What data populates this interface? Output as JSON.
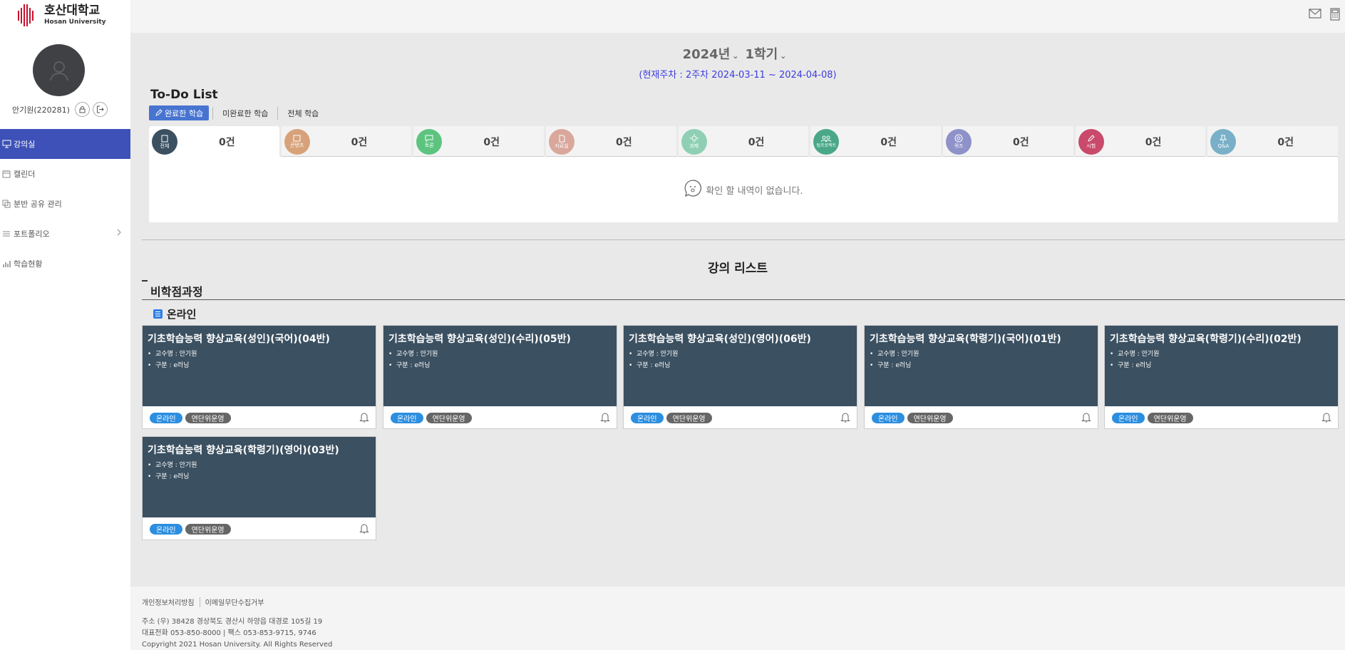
{
  "brand": {
    "name_ko": "호산대학교",
    "name_en": "Hosan University",
    "color": "#c8102e"
  },
  "user": {
    "name_id": "안기원(220281)"
  },
  "nav": {
    "items": [
      {
        "label": "강의실",
        "icon": "monitor-icon",
        "active": true
      },
      {
        "label": "캘린더",
        "icon": "calendar-icon"
      },
      {
        "label": "분반 공유 관리",
        "icon": "share-icon"
      },
      {
        "label": "포트폴리오",
        "icon": "list-icon",
        "expandable": true
      },
      {
        "label": "학습현황",
        "icon": "bar-chart-icon"
      }
    ]
  },
  "header": {
    "icons": [
      "mail-icon",
      "calculator-icon"
    ]
  },
  "term": {
    "year": "2024년",
    "semester": "1학기",
    "week": "(현재주차 : 2주차 2024-03-11 ~ 2024-04-08)"
  },
  "todo": {
    "title": "To-Do List",
    "filters": [
      "완료한 학습",
      "미완료한 학습",
      "전체 학습"
    ],
    "active_filter": "완료한 학습",
    "categories": [
      {
        "label": "전체",
        "count": "0건",
        "color": "#3b5061",
        "icon": "clipboard-icon"
      },
      {
        "label": "콘텐츠",
        "count": "0건",
        "color": "#d7a27a",
        "icon": "content-icon"
      },
      {
        "label": "토론",
        "count": "0건",
        "color": "#5dc47f",
        "icon": "discussion-icon"
      },
      {
        "label": "자료실",
        "count": "0건",
        "color": "#d9a79b",
        "icon": "folder-icon"
      },
      {
        "label": "과제",
        "count": "0건",
        "color": "#8fd0b5",
        "icon": "assignment-icon"
      },
      {
        "label": "팀프로젝트",
        "count": "0건",
        "color": "#4aa889",
        "icon": "team-icon"
      },
      {
        "label": "퀴즈",
        "count": "0건",
        "color": "#8f91c9",
        "icon": "quiz-icon"
      },
      {
        "label": "시험",
        "count": "0건",
        "color": "#c94a6a",
        "icon": "exam-icon"
      },
      {
        "label": "Q&A",
        "count": "0건",
        "color": "#79b0c8",
        "icon": "pin-icon"
      }
    ],
    "empty_message": "확인 할 내역이 없습니다."
  },
  "lecture": {
    "title": "강의 리스트",
    "track": "비학점과정",
    "section": "온라인",
    "courses": [
      {
        "title": "기초학습능력 향상교육(성인)(국어)(04반)",
        "professor": "교수명 : 안기원",
        "type": "구분 : e러닝",
        "tag1": "온라인",
        "tag2": "연단위운영"
      },
      {
        "title": "기초학습능력 향상교육(성인)(수리)(05반)",
        "professor": "교수명 : 안기원",
        "type": "구분 : e러닝",
        "tag1": "온라인",
        "tag2": "연단위운영"
      },
      {
        "title": "기초학습능력 향상교육(성인)(영어)(06반)",
        "professor": "교수명 : 안기원",
        "type": "구분 : e러닝",
        "tag1": "온라인",
        "tag2": "연단위운영"
      },
      {
        "title": "기초학습능력 향상교육(학령기)(국어)(01반)",
        "professor": "교수명 : 안기원",
        "type": "구분 : e러닝",
        "tag1": "온라인",
        "tag2": "연단위운영"
      },
      {
        "title": "기초학습능력 향상교육(학령기)(수리)(02반)",
        "professor": "교수명 : 안기원",
        "type": "구분 : e러닝",
        "tag1": "온라인",
        "tag2": "연단위운영"
      },
      {
        "title": "기초학습능력 향상교육(학령기)(영어)(03반)",
        "professor": "교수명 : 안기원",
        "type": "구분 : e러닝",
        "tag1": "온라인",
        "tag2": "연단위운영"
      }
    ]
  },
  "footer": {
    "link1": "개인정보처리방침",
    "link2": "이메일무단수집거부",
    "address": "주소 (우) 38428 경상북도 경산시 하양읍 대경로 105길 19",
    "phone": "대표전화 053-850-8000 | 팩스 053-853-9715, 9746",
    "copyright": "Copyright 2021 Hosan University. All Rights Reserved"
  }
}
